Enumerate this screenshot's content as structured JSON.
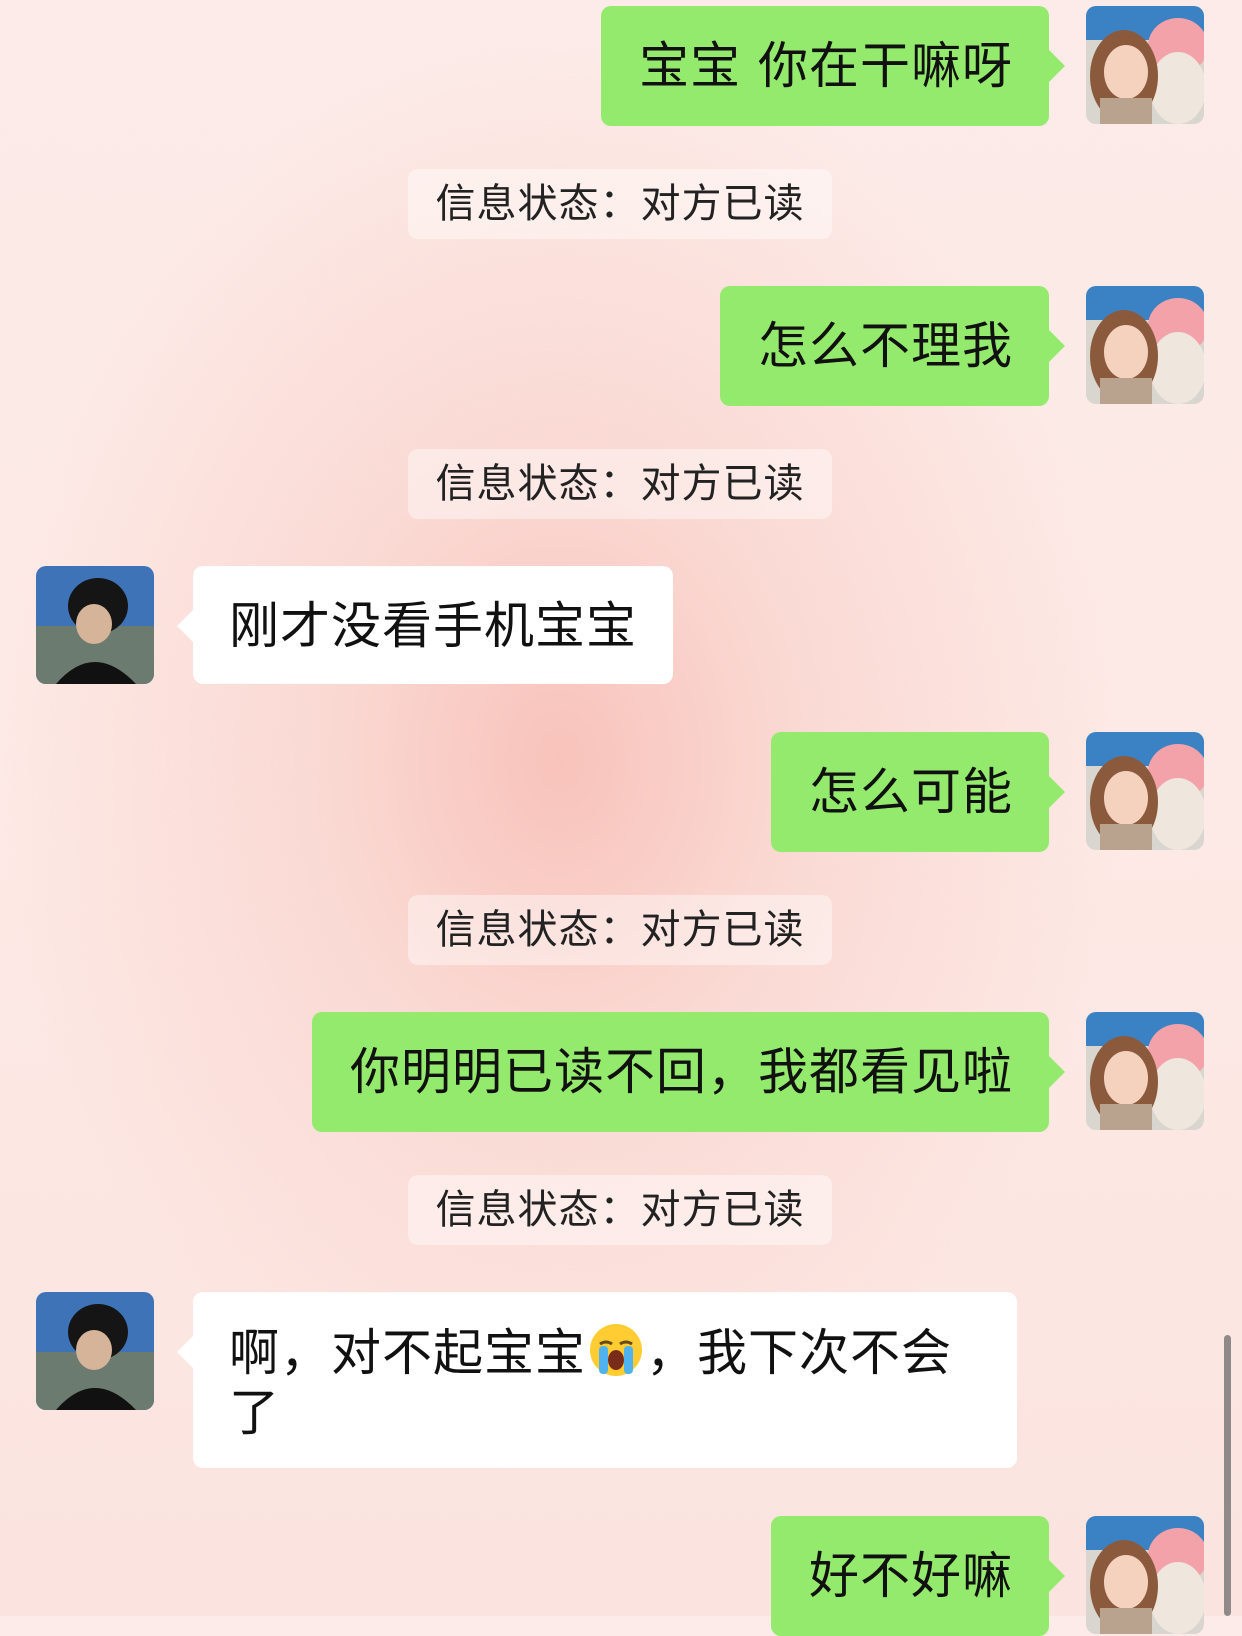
{
  "messages": [
    {
      "side": "out",
      "text": "宝宝 你在干嘛呀"
    },
    {
      "kind": "status",
      "text": "信息状态：对方已读"
    },
    {
      "side": "out",
      "text": "怎么不理我"
    },
    {
      "kind": "status",
      "text": "信息状态：对方已读"
    },
    {
      "side": "in",
      "text": "刚才没看手机宝宝"
    },
    {
      "side": "out",
      "text": "怎么可能"
    },
    {
      "kind": "status",
      "text": "信息状态：对方已读"
    },
    {
      "side": "out",
      "text": "你明明已读不回，我都看见啦"
    },
    {
      "kind": "status",
      "text": "信息状态：对方已读"
    },
    {
      "side": "in",
      "text_before_emoji": "啊，对不起宝宝",
      "emoji": "loudly-crying-face",
      "text_after_emoji": "，我下次不会了"
    },
    {
      "side": "out",
      "text": "好不好嘛"
    }
  ],
  "colors": {
    "outgoing_bubble": "#94ea6d",
    "incoming_bubble": "#ffffff",
    "background_pink": "#fbe4e0"
  },
  "avatars": {
    "self": "girl-selfie-avatar",
    "other": "boy-avatar"
  }
}
